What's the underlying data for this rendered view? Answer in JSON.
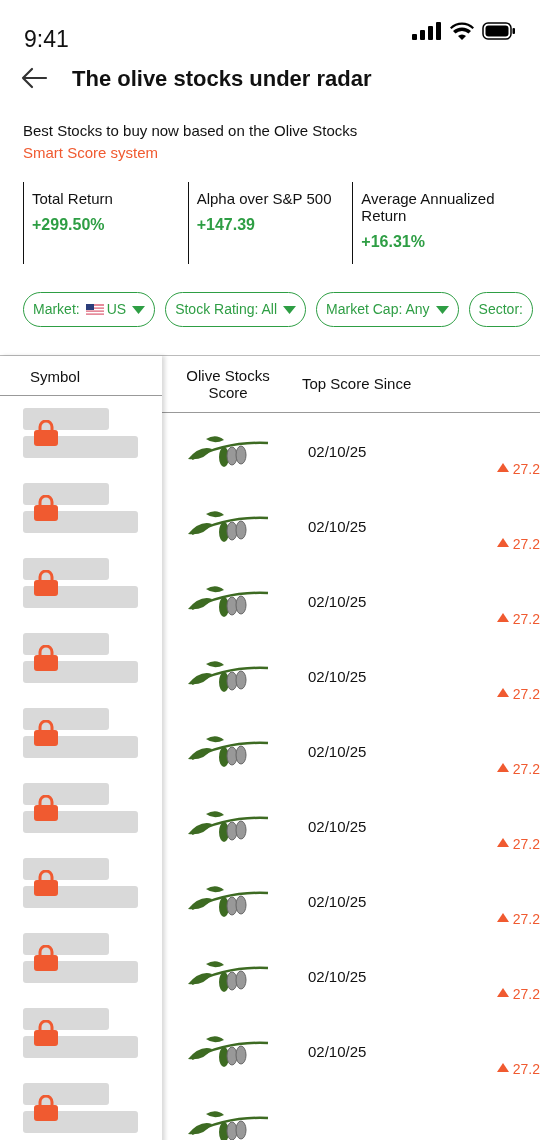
{
  "status_bar": {
    "time": "9:41"
  },
  "header": {
    "title": "The olive stocks under radar"
  },
  "description": {
    "text": "Best Stocks to buy now based on the Olive Stocks ",
    "link": "Smart Score system"
  },
  "stats": [
    {
      "label": "Total Return",
      "value": "+299.50%"
    },
    {
      "label": "Alpha over S&P 500",
      "value": "+147.39"
    },
    {
      "label": "Average Annualized Return",
      "value": "+16.31%"
    }
  ],
  "filters": [
    {
      "label": "Market:",
      "value": "US",
      "flag": true,
      "dropdown": true
    },
    {
      "label": "Stock Rating: All",
      "dropdown": true
    },
    {
      "label": "Market Cap: Any",
      "dropdown": true
    },
    {
      "label": "Sector:",
      "dropdown": false
    }
  ],
  "table": {
    "columns": [
      "Symbol",
      "Olive Stocks Score",
      "Top Score Since"
    ],
    "rows": [
      {
        "locked": true,
        "date": "02/10/25",
        "change": "27.2",
        "rising": true
      },
      {
        "locked": true,
        "date": "02/10/25",
        "change": "27.2",
        "rising": true
      },
      {
        "locked": true,
        "date": "02/10/25",
        "change": "27.2",
        "rising": true
      },
      {
        "locked": true,
        "date": "02/10/25",
        "change": "27.2",
        "rising": true
      },
      {
        "locked": true,
        "date": "02/10/25",
        "change": "27.2",
        "rising": true
      },
      {
        "locked": true,
        "date": "02/10/25",
        "change": "27.2",
        "rising": true
      },
      {
        "locked": true,
        "date": "02/10/25",
        "change": "27.2",
        "rising": true
      },
      {
        "locked": true,
        "date": "02/10/25",
        "change": "27.2",
        "rising": true
      },
      {
        "locked": true,
        "date": "02/10/25",
        "change": "27.2",
        "rising": true
      },
      {
        "locked": true
      }
    ]
  }
}
